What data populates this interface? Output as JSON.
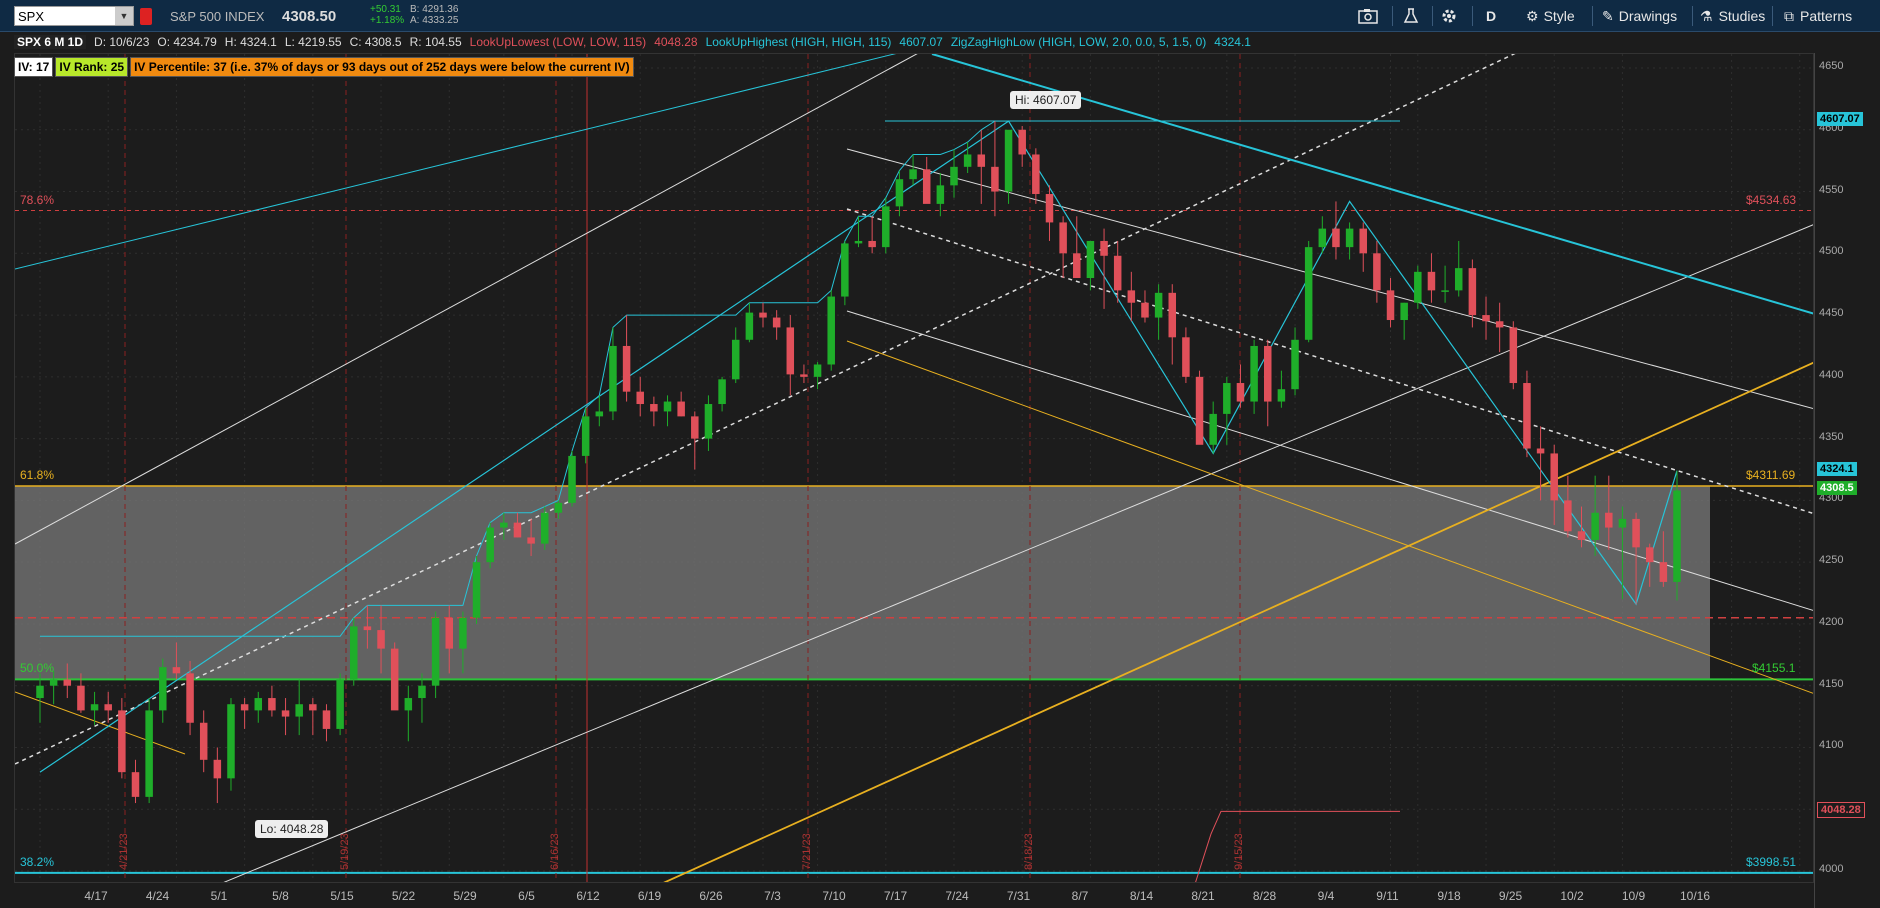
{
  "toolbar": {
    "symbol": "SPX",
    "name": "S&P 500 INDEX",
    "price": "4308.50",
    "change_abs": "+50.31",
    "change_pct": "+1.18%",
    "bid": "B: 4291.36",
    "ask": "A: 4333.25",
    "period": "D",
    "style_label": "Style",
    "drawings_label": "Drawings",
    "studies_label": "Studies",
    "patterns_label": "Patterns"
  },
  "info": {
    "title": "SPX 6 M 1D",
    "date": "D: 10/6/23",
    "open": "O: 4234.79",
    "high": "H: 4324.1",
    "low": "L: 4219.55",
    "close": "C: 4308.5",
    "range": "R: 104.55",
    "study1": "LookUpLowest (LOW, LOW, 115)",
    "study1_val": "4048.28",
    "study2": "LookUpHighest (HIGH, HIGH, 115)",
    "study2_val": "4607.07",
    "study3": "ZigZagHighLow (HIGH, LOW, 2.0, 0.0, 5, 1.5, 0)",
    "study3_val": "4324.1"
  },
  "iv": {
    "iv": "IV: 17",
    "rank": "IV Rank: 25",
    "percentile": "IV Percentile: 37 (i.e. 37% of days or 93 days out of 252 days were below the current IV)"
  },
  "annotations": {
    "hi": "Hi: 4607.07",
    "lo": "Lo: 4048.28"
  },
  "fib": {
    "f786": "78.6%",
    "f618": "61.8%",
    "f500": "50.0%",
    "f382": "38.2%",
    "v786": "$4534.63",
    "v618": "$4311.69",
    "v500": "$4155.1",
    "v382": "$3998.51"
  },
  "price_axis": {
    "ticks": [
      "4650",
      "4600",
      "4550",
      "4500",
      "4450",
      "4400",
      "4350",
      "4300",
      "4250",
      "4200",
      "4150",
      "4100",
      "4050",
      "4000"
    ],
    "tag_high": "4607.07",
    "tag_zz": "4324.1",
    "tag_last": "4308.5",
    "tag_low": "4048.28"
  },
  "time_axis": [
    "4/17",
    "4/24",
    "5/1",
    "5/8",
    "5/15",
    "5/22",
    "5/29",
    "6/5",
    "6/12",
    "6/19",
    "6/26",
    "7/3",
    "7/10",
    "7/17",
    "7/24",
    "7/31",
    "8/7",
    "8/14",
    "8/21",
    "8/28",
    "9/4",
    "9/11",
    "9/18",
    "9/25",
    "10/2",
    "10/9",
    "10/16"
  ],
  "vertical_dates": [
    "4/21/23",
    "5/19/23",
    "6/16/23",
    "7/21/23",
    "8/18/23",
    "9/15/23"
  ],
  "colors": {
    "up": "#1fae2a",
    "down": "#e0505a",
    "cyan": "#27c4d8",
    "yellow": "#e8b020",
    "fib_zone": "#7a7a7a"
  },
  "chart_data": {
    "type": "candlestick",
    "ylim": [
      3990,
      4660
    ],
    "x": [
      "4/17",
      "4/18",
      "4/19",
      "4/20",
      "4/21",
      "4/24",
      "4/25",
      "4/26",
      "4/27",
      "4/28",
      "5/1",
      "5/2",
      "5/3",
      "5/4",
      "5/5",
      "5/8",
      "5/9",
      "5/10",
      "5/11",
      "5/12",
      "5/15",
      "5/16",
      "5/17",
      "5/18",
      "5/19",
      "5/22",
      "5/23",
      "5/24",
      "5/25",
      "5/26",
      "5/30",
      "5/31",
      "6/1",
      "6/2",
      "6/5",
      "6/6",
      "6/7",
      "6/8",
      "6/9",
      "6/12",
      "6/13",
      "6/14",
      "6/15",
      "6/16",
      "6/20",
      "6/21",
      "6/22",
      "6/23",
      "6/26",
      "6/27",
      "6/28",
      "6/29",
      "6/30",
      "7/3",
      "7/5",
      "7/6",
      "7/7",
      "7/10",
      "7/11",
      "7/12",
      "7/13",
      "7/14",
      "7/17",
      "7/18",
      "7/19",
      "7/20",
      "7/21",
      "7/24",
      "7/25",
      "7/26",
      "7/27",
      "7/28",
      "7/31",
      "8/1",
      "8/2",
      "8/3",
      "8/4",
      "8/7",
      "8/8",
      "8/9",
      "8/10",
      "8/11",
      "8/14",
      "8/15",
      "8/16",
      "8/17",
      "8/18",
      "8/21",
      "8/22",
      "8/23",
      "8/24",
      "8/25",
      "8/28",
      "8/29",
      "8/30",
      "8/31",
      "9/1",
      "9/5",
      "9/6",
      "9/7",
      "9/8",
      "9/11",
      "9/12",
      "9/13",
      "9/14",
      "9/15",
      "9/18",
      "9/19",
      "9/20",
      "9/21",
      "9/22",
      "9/25",
      "9/26",
      "9/27",
      "9/28",
      "9/29",
      "10/2",
      "10/3",
      "10/4",
      "10/5",
      "10/6"
    ],
    "open": [
      4140,
      4150,
      4155,
      4150,
      4130,
      4135,
      4130,
      4080,
      4060,
      4130,
      4165,
      4160,
      4120,
      4090,
      4075,
      4135,
      4130,
      4140,
      4130,
      4125,
      4135,
      4130,
      4115,
      4155,
      4198,
      4195,
      4180,
      4130,
      4140,
      4150,
      4205,
      4180,
      4205,
      4250,
      4278,
      4282,
      4270,
      4265,
      4290,
      4298,
      4336,
      4368,
      4372,
      4425,
      4388,
      4378,
      4372,
      4380,
      4368,
      4350,
      4378,
      4398,
      4430,
      4452,
      4448,
      4440,
      4402,
      4400,
      4410,
      4465,
      4508,
      4510,
      4505,
      4538,
      4560,
      4568,
      4540,
      4555,
      4570,
      4580,
      4570,
      4550,
      4600,
      4580,
      4548,
      4525,
      4500,
      4480,
      4510,
      4498,
      4470,
      4460,
      4448,
      4468,
      4432,
      4400,
      4345,
      4370,
      4395,
      4380,
      4425,
      4380,
      4390,
      4430,
      4505,
      4520,
      4505,
      4520,
      4500,
      4470,
      4446,
      4460,
      4485,
      4470,
      4470,
      4488,
      4450,
      4445,
      4440,
      4395,
      4342,
      4338,
      4300,
      4275,
      4268,
      4290,
      4278,
      4285,
      4262,
      4250,
      4234
    ],
    "high": [
      4160,
      4162,
      4168,
      4160,
      4145,
      4145,
      4140,
      4090,
      4140,
      4172,
      4185,
      4170,
      4130,
      4100,
      4140,
      4140,
      4145,
      4150,
      4140,
      4155,
      4140,
      4135,
      4160,
      4205,
      4215,
      4215,
      4185,
      4150,
      4160,
      4210,
      4215,
      4210,
      4255,
      4282,
      4290,
      4290,
      4285,
      4295,
      4300,
      4340,
      4375,
      4385,
      4440,
      4450,
      4400,
      4384,
      4385,
      4388,
      4372,
      4385,
      4400,
      4440,
      4460,
      4460,
      4454,
      4450,
      4410,
      4412,
      4470,
      4510,
      4530,
      4530,
      4545,
      4567,
      4580,
      4578,
      4565,
      4584,
      4590,
      4600,
      4607,
      4590,
      4603,
      4585,
      4555,
      4530,
      4530,
      4510,
      4520,
      4510,
      4485,
      4470,
      4475,
      4475,
      4440,
      4405,
      4380,
      4400,
      4410,
      4430,
      4430,
      4405,
      4440,
      4510,
      4530,
      4542,
      4525,
      4525,
      4510,
      4480,
      4460,
      4490,
      4500,
      4490,
      4510,
      4495,
      4465,
      4460,
      4445,
      4405,
      4360,
      4345,
      4320,
      4295,
      4320,
      4320,
      4295,
      4290,
      4265,
      4275,
      4324
    ],
    "low": [
      4120,
      4135,
      4140,
      4128,
      4118,
      4120,
      4075,
      4055,
      4055,
      4120,
      4155,
      4110,
      4080,
      4055,
      4065,
      4115,
      4120,
      4125,
      4110,
      4110,
      4110,
      4105,
      4110,
      4150,
      4180,
      4160,
      4135,
      4105,
      4120,
      4140,
      4160,
      4160,
      4200,
      4245,
      4268,
      4270,
      4255,
      4260,
      4285,
      4295,
      4330,
      4360,
      4365,
      4380,
      4368,
      4360,
      4360,
      4368,
      4325,
      4340,
      4372,
      4395,
      4428,
      4440,
      4430,
      4385,
      4395,
      4390,
      4405,
      4458,
      4505,
      4500,
      4500,
      4530,
      4555,
      4550,
      4530,
      4545,
      4565,
      4540,
      4530,
      4540,
      4570,
      4540,
      4510,
      4480,
      4480,
      4470,
      4455,
      4460,
      4445,
      4444,
      4430,
      4410,
      4395,
      4365,
      4338,
      4345,
      4375,
      4370,
      4360,
      4375,
      4385,
      4428,
      4500,
      4495,
      4495,
      4485,
      4460,
      4440,
      4430,
      4455,
      4460,
      4460,
      4465,
      4440,
      4430,
      4420,
      4390,
      4335,
      4300,
      4280,
      4270,
      4262,
      4255,
      4260,
      4220,
      4216,
      4230,
      4230,
      4219
    ],
    "close": [
      4150,
      4155,
      4150,
      4130,
      4135,
      4130,
      4080,
      4060,
      4130,
      4165,
      4160,
      4120,
      4090,
      4075,
      4135,
      4130,
      4140,
      4130,
      4125,
      4135,
      4130,
      4115,
      4155,
      4198,
      4195,
      4180,
      4130,
      4140,
      4150,
      4205,
      4180,
      4205,
      4250,
      4278,
      4282,
      4270,
      4265,
      4290,
      4298,
      4336,
      4368,
      4372,
      4425,
      4388,
      4378,
      4372,
      4380,
      4368,
      4350,
      4378,
      4398,
      4430,
      4452,
      4448,
      4440,
      4402,
      4400,
      4410,
      4465,
      4508,
      4510,
      4505,
      4538,
      4560,
      4568,
      4540,
      4555,
      4570,
      4580,
      4570,
      4550,
      4600,
      4580,
      4548,
      4525,
      4500,
      4480,
      4510,
      4498,
      4470,
      4460,
      4448,
      4468,
      4432,
      4400,
      4345,
      4370,
      4395,
      4380,
      4425,
      4380,
      4390,
      4430,
      4505,
      4520,
      4505,
      4520,
      4500,
      4470,
      4446,
      4460,
      4485,
      4470,
      4470,
      4488,
      4450,
      4445,
      4440,
      4395,
      4342,
      4338,
      4300,
      4275,
      4268,
      4290,
      4278,
      4285,
      4262,
      4250,
      4234,
      4308
    ]
  }
}
